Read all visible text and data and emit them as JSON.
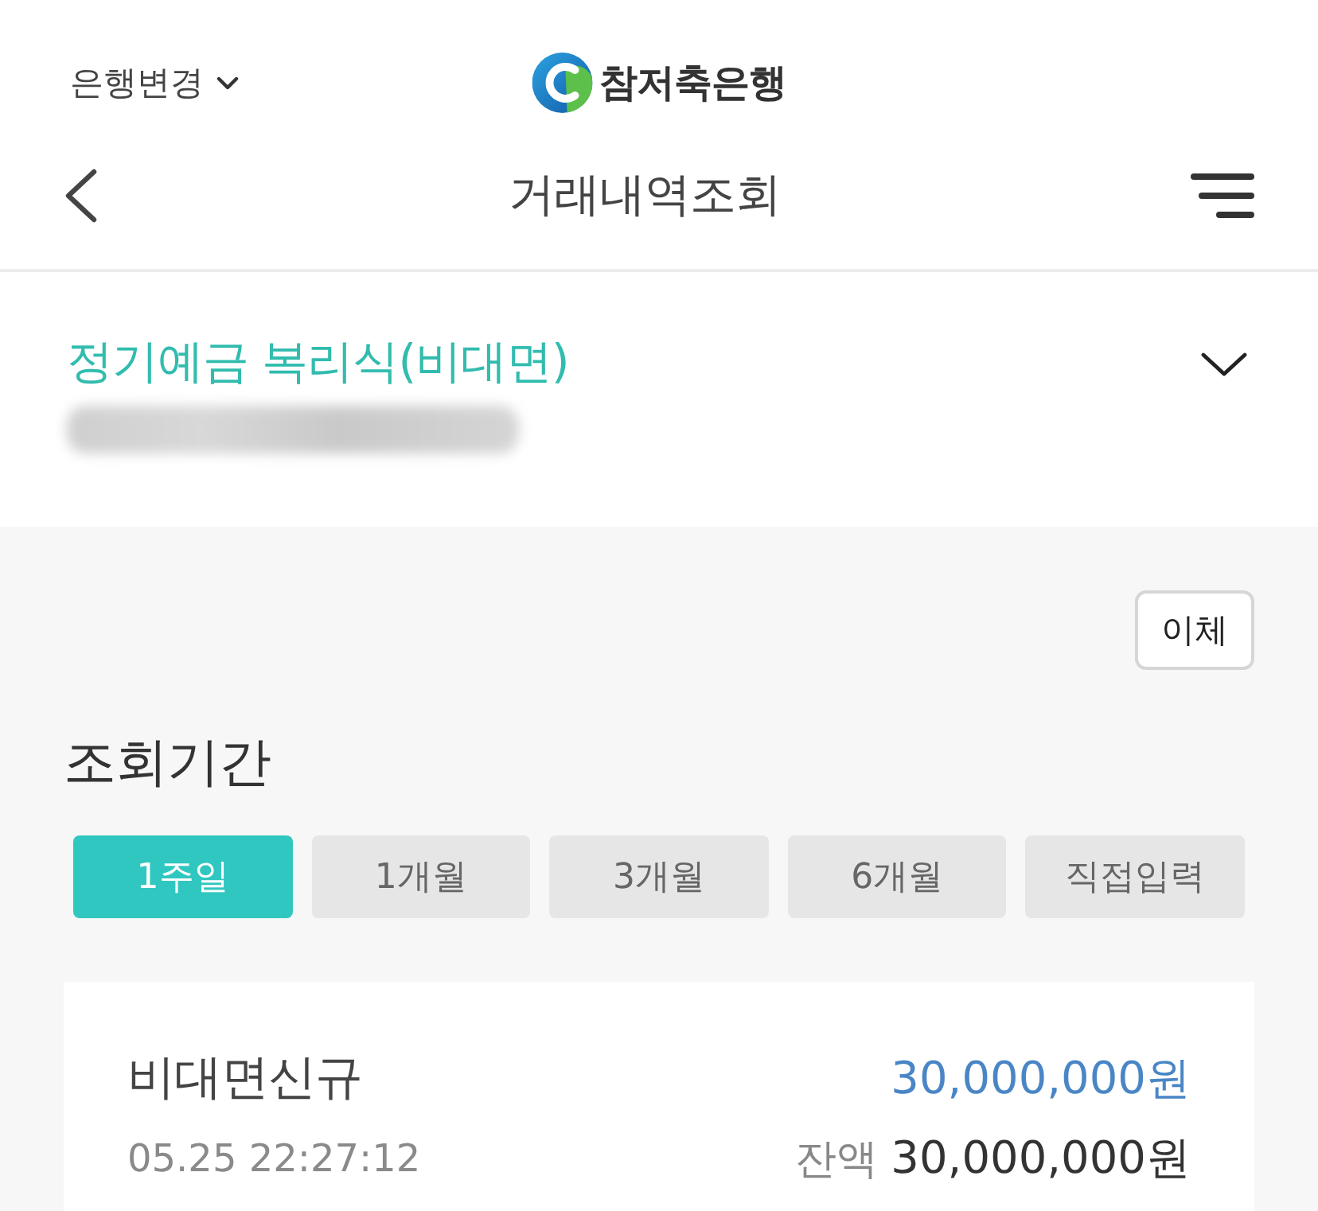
{
  "top_bar": {
    "bank_switch": "은행변경",
    "logo_text": "참저축은행"
  },
  "nav": {
    "title": "거래내역조회"
  },
  "account": {
    "name": "정기예금 복리식(비대면)"
  },
  "transfer_button": "이체",
  "period": {
    "heading": "조회기간",
    "options": [
      {
        "label": "1주일",
        "selected": true
      },
      {
        "label": "1개월",
        "selected": false
      },
      {
        "label": "3개월",
        "selected": false
      },
      {
        "label": "6개월",
        "selected": false
      },
      {
        "label": "직접입력",
        "selected": false
      }
    ]
  },
  "transactions": [
    {
      "description": "비대면신규",
      "datetime": "05.25 22:27:12",
      "amount": "30,000,000원",
      "balance_label": "잔액",
      "balance": "30,000,000원"
    }
  ]
}
